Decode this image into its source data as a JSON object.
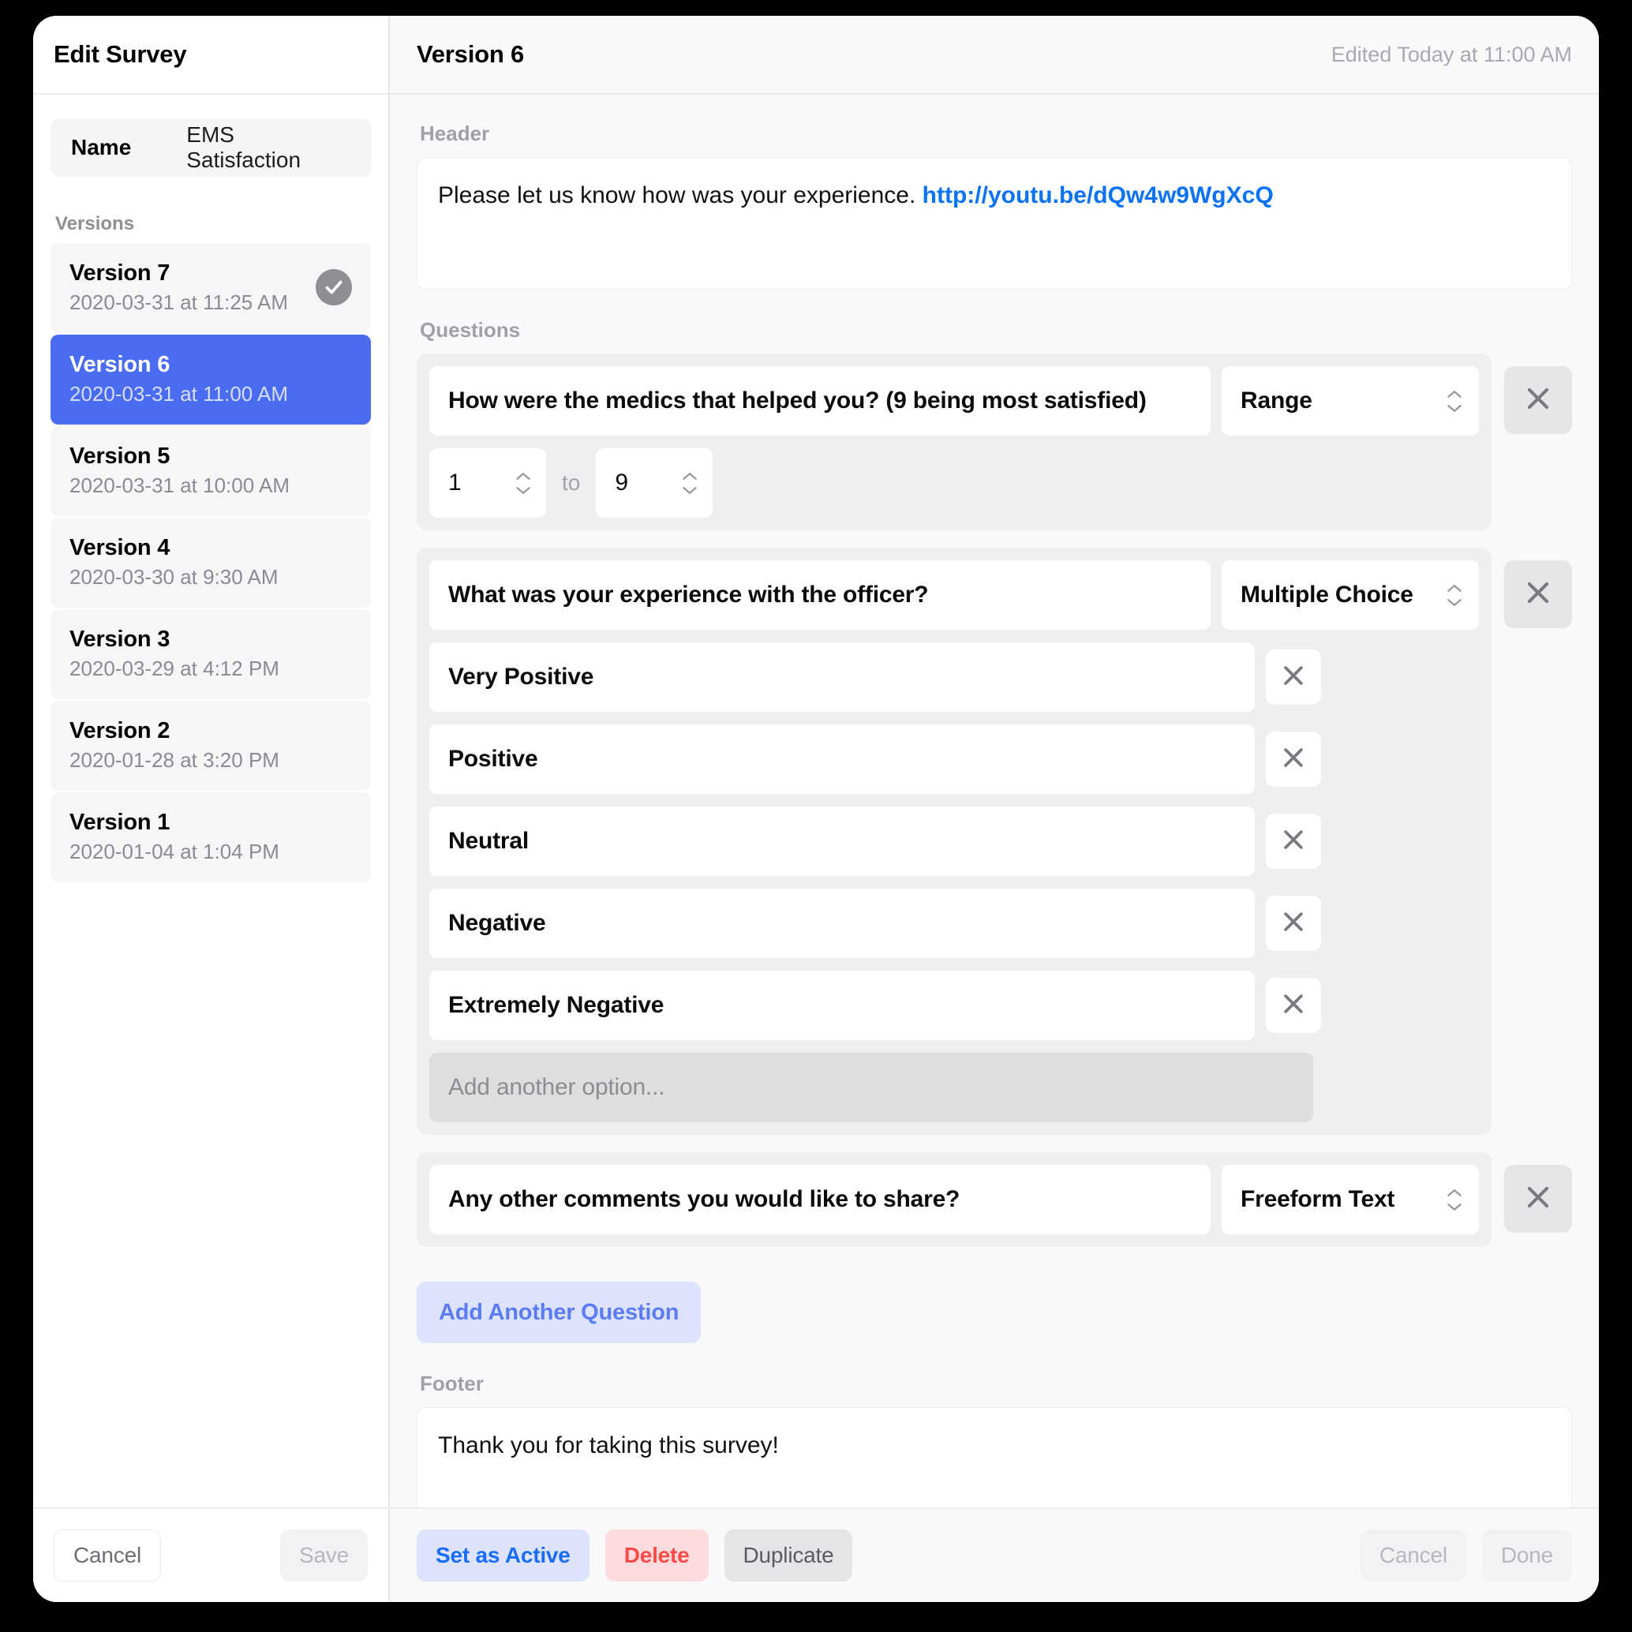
{
  "sidebar": {
    "title": "Edit Survey",
    "name_label": "Name",
    "name_value": "EMS Satisfaction",
    "versions_label": "Versions",
    "versions": [
      {
        "name": "Version 7",
        "date": "2020-03-31 at 11:25 AM",
        "active": true,
        "selected": false
      },
      {
        "name": "Version 6",
        "date": "2020-03-31 at 11:00 AM",
        "active": false,
        "selected": true
      },
      {
        "name": "Version 5",
        "date": "2020-03-31 at 10:00 AM",
        "active": false,
        "selected": false
      },
      {
        "name": "Version 4",
        "date": "2020-03-30 at 9:30 AM",
        "active": false,
        "selected": false
      },
      {
        "name": "Version 3",
        "date": "2020-03-29 at 4:12 PM",
        "active": false,
        "selected": false
      },
      {
        "name": "Version 2",
        "date": "2020-01-28 at 3:20 PM",
        "active": false,
        "selected": false
      },
      {
        "name": "Version 1",
        "date": "2020-01-04 at 1:04 PM",
        "active": false,
        "selected": false
      }
    ],
    "cancel_label": "Cancel",
    "save_label": "Save"
  },
  "main": {
    "title": "Version 6",
    "edited": "Edited Today at 11:00 AM",
    "header_label": "Header",
    "header_text": "Please let us know how was your experience.",
    "header_link": "http://youtu.be/dQw4w9WgXcQ",
    "questions_label": "Questions",
    "questions": [
      {
        "title": "How were the medics that helped you? (9 being most satisfied)",
        "type": "Range",
        "range_min": "1",
        "range_to": "to",
        "range_max": "9",
        "options": []
      },
      {
        "title": "What was your experience with the officer?",
        "type": "Multiple Choice",
        "options": [
          "Very Positive",
          "Positive",
          "Neutral",
          "Negative",
          "Extremely Negative"
        ],
        "add_option_placeholder": "Add another option..."
      },
      {
        "title": "Any other comments you would like to share?",
        "type": "Freeform Text",
        "options": []
      }
    ],
    "add_question_label": "Add Another Question",
    "footer_label": "Footer",
    "footer_text": "Thank you for taking this survey!",
    "set_active_label": "Set as Active",
    "delete_label": "Delete",
    "duplicate_label": "Duplicate",
    "cancel_label": "Cancel",
    "done_label": "Done"
  },
  "colors": {
    "accent_blue": "#4a6cf0",
    "link_blue": "#0a72f5",
    "danger_red": "#fb4a47",
    "active_badge_gray": "#8e8e93"
  }
}
